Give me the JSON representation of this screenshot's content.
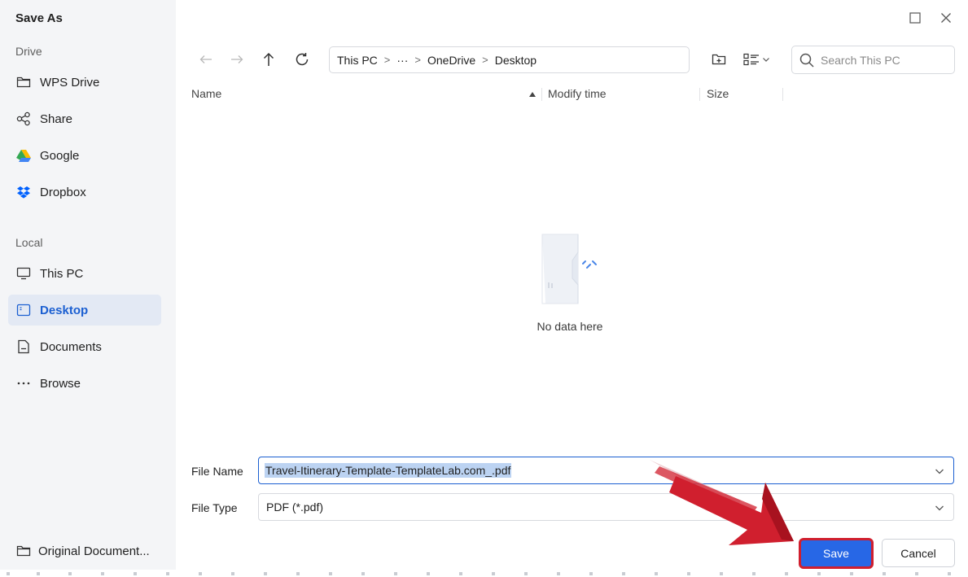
{
  "dialog": {
    "title": "Save As"
  },
  "sidebar": {
    "drive_label": "Drive",
    "drive_items": [
      {
        "label": "WPS Drive",
        "icon": "folder-icon"
      },
      {
        "label": "Share",
        "icon": "share-icon"
      },
      {
        "label": "Google",
        "icon": "google-drive-icon"
      },
      {
        "label": "Dropbox",
        "icon": "dropbox-icon"
      }
    ],
    "local_label": "Local",
    "local_items": [
      {
        "label": "This PC",
        "icon": "monitor-icon"
      },
      {
        "label": "Desktop",
        "icon": "desktop-icon",
        "active": true
      },
      {
        "label": "Documents",
        "icon": "document-icon"
      },
      {
        "label": "Browse",
        "icon": "more-icon"
      }
    ],
    "bottom_item": {
      "label": "Original Document...",
      "icon": "folder-icon"
    }
  },
  "breadcrumb": {
    "items": [
      "This PC",
      "···",
      "OneDrive",
      "Desktop"
    ],
    "separator": ">"
  },
  "search": {
    "placeholder": "Search This PC"
  },
  "columns": {
    "name": "Name",
    "modify_time": "Modify time",
    "size": "Size"
  },
  "empty_state": {
    "text": "No data here"
  },
  "form": {
    "file_name_label": "File Name",
    "file_name_value": "Travel-Itinerary-Template-TemplateLab.com_.pdf",
    "file_type_label": "File Type",
    "file_type_value": "PDF (*.pdf)"
  },
  "buttons": {
    "save": "Save",
    "cancel": "Cancel"
  },
  "colors": {
    "accent": "#2767e6",
    "active_bg": "#e3e9f4",
    "active_text": "#1b5fd1",
    "highlight_red": "#d01f2e",
    "sidebar_bg": "#f4f5f7"
  }
}
